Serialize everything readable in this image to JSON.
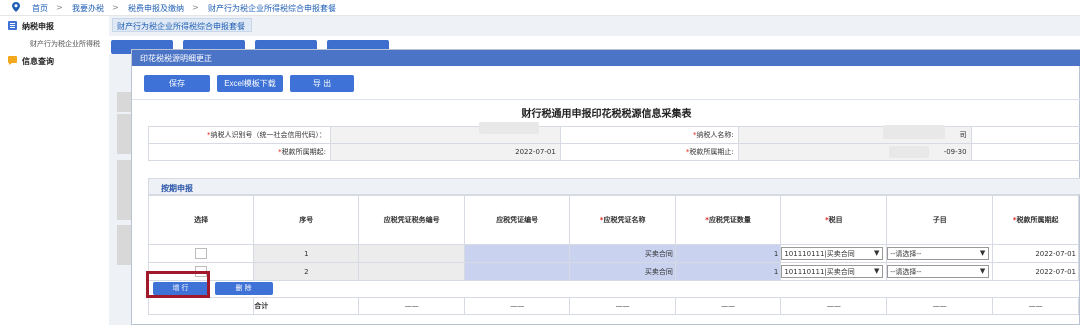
{
  "breadcrumb": {
    "items": [
      "首页",
      ">",
      "我要办税",
      ">",
      "税费申报及缴纳",
      ">",
      "财产行为税企业所得税综合申报套餐"
    ]
  },
  "sidebar": {
    "items": [
      {
        "label": "纳税申报"
      },
      {
        "label": "财产行为税企业所得税"
      },
      {
        "label": "信息查询"
      }
    ]
  },
  "background_tab": {
    "label": "财产行为税企业所得税综合申报套餐"
  },
  "modal": {
    "title": "印花税税源明细更正",
    "toolbar": {
      "save": "保存",
      "excel": "Excel模板下载",
      "export": "导 出"
    },
    "form_title": "财行税通用申报印花税税源信息采集表",
    "info": {
      "taxpayer_id_label": "纳税人识别号（统一社会信用代码）：",
      "taxpayer_name_label": "纳税人名称:",
      "name_suffix": "司",
      "period_start_label": "税款所属期起:",
      "period_start_value": "2022-07-01",
      "period_end_label": "税款所属期止:",
      "period_end_value": "-09-30"
    },
    "section_title": "按期申报",
    "table": {
      "headers": [
        "选择",
        "序号",
        "应税凭证税务编号",
        "应税凭证编号",
        "应税凭证名称",
        "应税凭证数量",
        "税目",
        "子目",
        "税款所属期起"
      ],
      "rows": [
        {
          "seq": "1",
          "name": "买卖合同",
          "qty": "1",
          "item": "101110111|买卖合同",
          "subitem": "--请选择--",
          "start": "2022-07-01"
        },
        {
          "seq": "2",
          "name": "买卖合同",
          "qty": "1",
          "item": "101110111|买卖合同",
          "subitem": "--请选择--",
          "start": "2022-07-01"
        }
      ],
      "total_label": "合计",
      "dash": "——"
    },
    "row_buttons": {
      "add": "增 行",
      "delete": "删 除"
    }
  }
}
